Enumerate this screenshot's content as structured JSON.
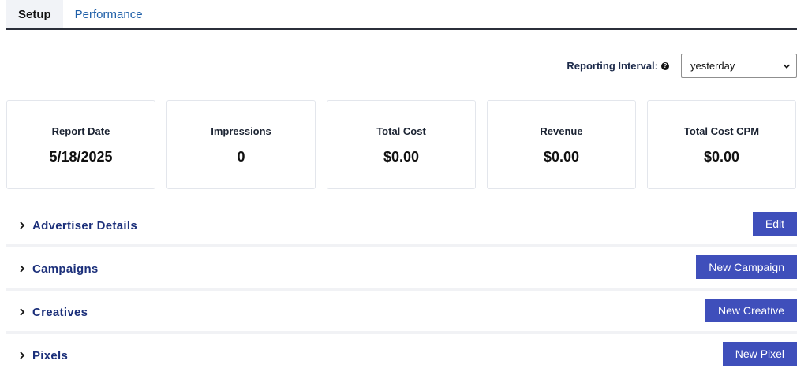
{
  "tabs": [
    {
      "label": "Setup",
      "active": true
    },
    {
      "label": "Performance",
      "active": false
    }
  ],
  "interval": {
    "label": "Reporting Interval:",
    "help_icon": "question-circle-icon",
    "selected": "yesterday"
  },
  "stats": [
    {
      "label": "Report Date",
      "value": "5/18/2025"
    },
    {
      "label": "Impressions",
      "value": "0"
    },
    {
      "label": "Total Cost",
      "value": "$0.00"
    },
    {
      "label": "Revenue",
      "value": "$0.00"
    },
    {
      "label": "Total Cost CPM",
      "value": "$0.00"
    }
  ],
  "sections": [
    {
      "title": "Advertiser Details",
      "button": "Edit"
    },
    {
      "title": "Campaigns",
      "button": "New Campaign"
    },
    {
      "title": "Creatives",
      "button": "New Creative"
    },
    {
      "title": "Pixels",
      "button": "New Pixel"
    }
  ],
  "colors": {
    "accent_button": "#3f4fbb",
    "section_title": "#1b2f7a",
    "tab_link": "#1f5fa8"
  }
}
